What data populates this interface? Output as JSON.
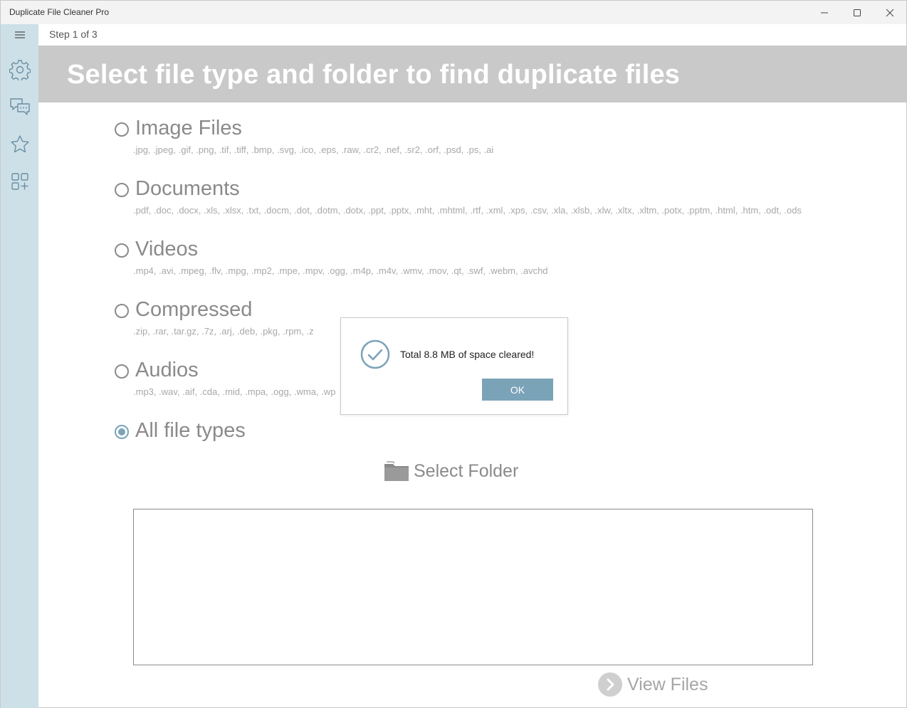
{
  "window": {
    "title": "Duplicate File Cleaner Pro"
  },
  "header": {
    "step": "Step 1 of 3",
    "banner_title": "Select file type and folder to find duplicate files"
  },
  "sidebar": {
    "items": [
      {
        "icon": "hamburger-menu-icon"
      },
      {
        "icon": "gear-icon"
      },
      {
        "icon": "chat-icon"
      },
      {
        "icon": "star-icon"
      },
      {
        "icon": "apps-add-icon"
      }
    ]
  },
  "file_types": [
    {
      "label": "Image Files",
      "extensions": ".jpg, .jpeg, .gif, .png, .tif, .tiff, .bmp, .svg, .ico, .eps, .raw, .cr2, .nef, .sr2, .orf, .psd, .ps, .ai",
      "selected": false
    },
    {
      "label": "Documents",
      "extensions": ".pdf, .doc, .docx, .xls, .xlsx, .txt, .docm, .dot, .dotm, .dotx, .ppt, .pptx, .mht, .mhtml, .rtf, .xml, .xps, .csv, .xla, .xlsb, .xlw, .xltx, .xltm, .potx, .pptm, .html, .htm, .odt, .ods",
      "selected": false
    },
    {
      "label": "Videos",
      "extensions": ".mp4, .avi, .mpeg, .flv, .mpg, .mp2, .mpe, .mpv, .ogg, .m4p, .m4v, .wmv, .mov, .qt, .swf, .webm, .avchd",
      "selected": false
    },
    {
      "label": "Compressed",
      "extensions": ".zip, .rar, .tar.gz, .7z, .arj, .deb, .pkg, .rpm, .z",
      "selected": false
    },
    {
      "label": "Audios",
      "extensions": ".mp3, .wav, .aif, .cda, .mid, .mpa, .ogg, .wma, .wp",
      "selected": false
    },
    {
      "label": "All file types",
      "extensions": "",
      "selected": true
    }
  ],
  "actions": {
    "select_folder": "Select Folder",
    "view_files": "View Files"
  },
  "dialog": {
    "message": "Total 8.8 MB of space cleared!",
    "ok_label": "OK"
  },
  "colors": {
    "accent": "#7aa3b8",
    "sidebar": "#cde0e8",
    "banner": "#c9c9c9"
  }
}
